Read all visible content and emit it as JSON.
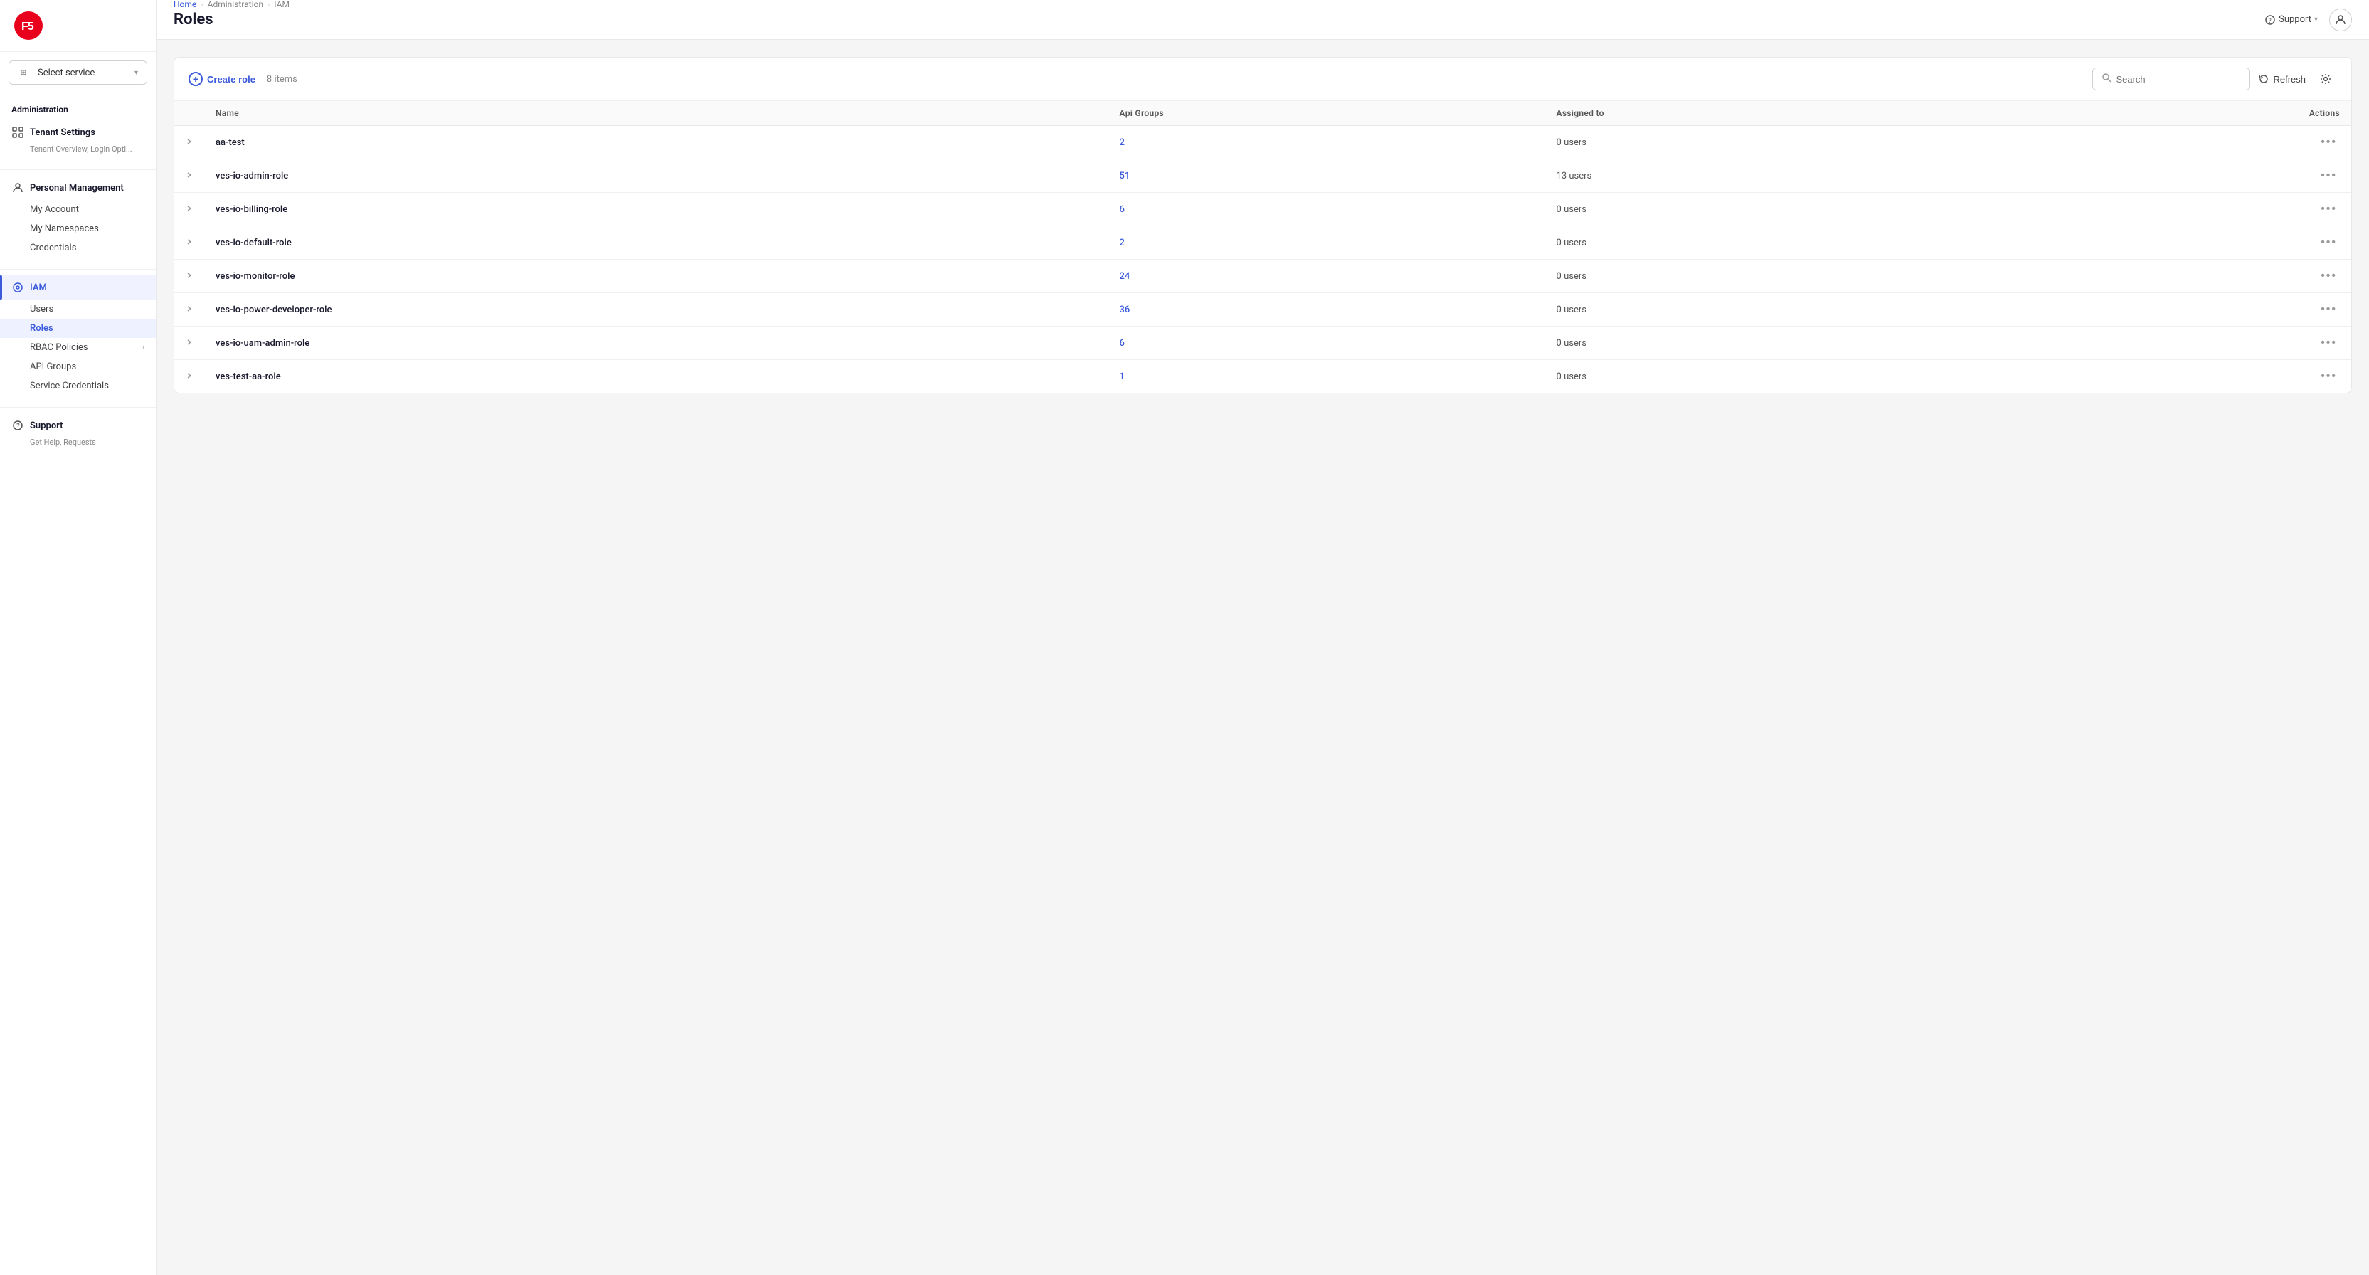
{
  "app": {
    "logo_text": "F5"
  },
  "sidebar": {
    "select_service_label": "Select service",
    "administration_label": "Administration",
    "sections": [
      {
        "id": "tenant-settings",
        "icon": "⊞",
        "label": "Tenant Settings",
        "sublabel": "Tenant Overview, Login Opti...",
        "active": false
      },
      {
        "id": "personal-management",
        "icon": "👤",
        "label": "Personal Management",
        "sublabel": null,
        "active": false,
        "items": [
          {
            "id": "my-account",
            "label": "My Account",
            "active": false
          },
          {
            "id": "my-namespaces",
            "label": "My Namespaces",
            "active": false
          },
          {
            "id": "credentials",
            "label": "Credentials",
            "active": false
          }
        ]
      },
      {
        "id": "iam",
        "icon": "⊙",
        "label": "IAM",
        "sublabel": null,
        "active": true,
        "items": [
          {
            "id": "users",
            "label": "Users",
            "active": false
          },
          {
            "id": "roles",
            "label": "Roles",
            "active": true
          },
          {
            "id": "rbac-policies",
            "label": "RBAC Policies",
            "active": false,
            "has_arrow": true
          },
          {
            "id": "api-groups",
            "label": "API Groups",
            "active": false
          },
          {
            "id": "service-credentials",
            "label": "Service Credentials",
            "active": false
          }
        ]
      },
      {
        "id": "support",
        "icon": "?",
        "label": "Support",
        "sublabel": "Get Help, Requests",
        "active": false
      }
    ]
  },
  "topbar": {
    "breadcrumbs": [
      {
        "label": "Home",
        "link": true
      },
      {
        "label": "Administration",
        "link": false
      },
      {
        "label": "IAM",
        "link": false
      }
    ],
    "support_label": "Support",
    "page_title": "Roles"
  },
  "table": {
    "create_button_label": "Create role",
    "items_count_label": "8 items",
    "search_placeholder": "Search",
    "refresh_label": "Refresh",
    "columns": [
      {
        "id": "name",
        "label": "Name"
      },
      {
        "id": "api_groups",
        "label": "Api Groups"
      },
      {
        "id": "assigned_to",
        "label": "Assigned to"
      },
      {
        "id": "actions",
        "label": "Actions"
      }
    ],
    "rows": [
      {
        "id": 1,
        "name": "aa-test",
        "api_groups": "2",
        "assigned_to": "0 users"
      },
      {
        "id": 2,
        "name": "ves-io-admin-role",
        "api_groups": "51",
        "assigned_to": "13 users"
      },
      {
        "id": 3,
        "name": "ves-io-billing-role",
        "api_groups": "6",
        "assigned_to": "0 users"
      },
      {
        "id": 4,
        "name": "ves-io-default-role",
        "api_groups": "2",
        "assigned_to": "0 users"
      },
      {
        "id": 5,
        "name": "ves-io-monitor-role",
        "api_groups": "24",
        "assigned_to": "0 users"
      },
      {
        "id": 6,
        "name": "ves-io-power-developer-role",
        "api_groups": "36",
        "assigned_to": "0 users"
      },
      {
        "id": 7,
        "name": "ves-io-uam-admin-role",
        "api_groups": "6",
        "assigned_to": "0 users"
      },
      {
        "id": 8,
        "name": "ves-test-aa-role",
        "api_groups": "1",
        "assigned_to": "0 users"
      }
    ]
  }
}
